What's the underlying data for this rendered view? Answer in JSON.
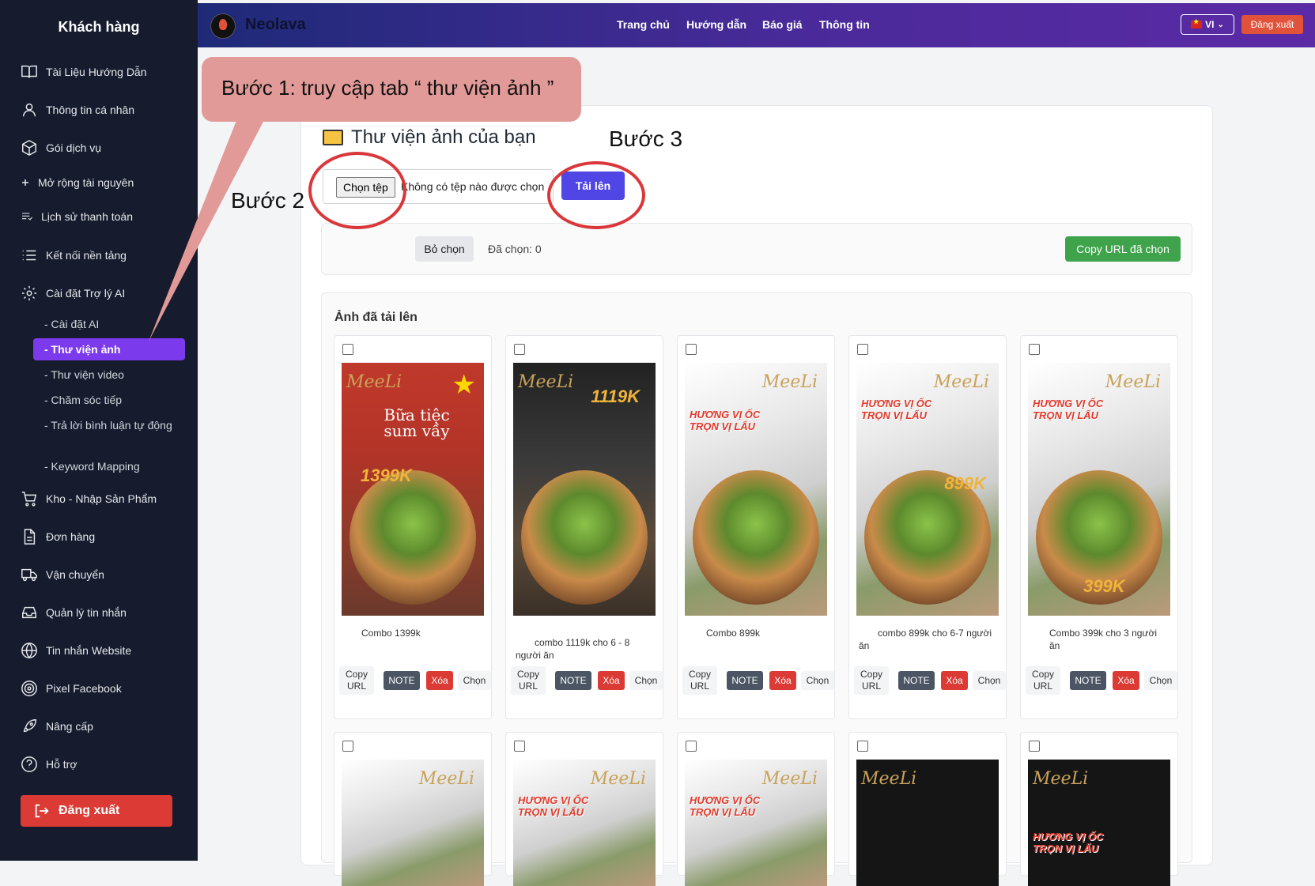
{
  "sidebar": {
    "title": "Khách hàng",
    "items": [
      {
        "label": "Tài Liệu Hướng Dẫn",
        "icon": "book-icon"
      },
      {
        "label": "Thông tin cá nhân",
        "icon": "user-icon"
      },
      {
        "label": "Gói dịch vụ",
        "icon": "box-icon"
      },
      {
        "label": "Mở rộng tài nguyên",
        "icon": "plus-icon"
      },
      {
        "label": "Lịch sử thanh toán",
        "icon": "list-icon"
      },
      {
        "label": "Kết nối nền tảng",
        "icon": "menu-icon"
      },
      {
        "label": "Cài đặt Trợ lý AI",
        "icon": "gear-icon"
      },
      {
        "label": "Kho - Nhập Sản Phẩm",
        "icon": "cart-icon"
      },
      {
        "label": "Đơn hàng",
        "icon": "document-icon"
      },
      {
        "label": "Vận chuyển",
        "icon": "truck-icon"
      },
      {
        "label": "Quản lý tin nhắn",
        "icon": "inbox-icon"
      },
      {
        "label": "Tin nhắn Website",
        "icon": "globe-icon"
      },
      {
        "label": "Pixel Facebook",
        "icon": "target-icon"
      },
      {
        "label": "Nâng cấp",
        "icon": "rocket-icon"
      },
      {
        "label": "Hỗ trợ",
        "icon": "help-icon"
      }
    ],
    "subitems": [
      "- Cài đặt AI",
      "- Thư viện ảnh",
      "- Thư viện video",
      "- Chăm sóc tiếp",
      "- Trả lời bình luận tự động",
      "- Keyword Mapping"
    ],
    "logout": "Đăng xuất"
  },
  "topbar": {
    "brand": "Neolava",
    "nav": [
      "Trang chủ",
      "Hướng dẫn",
      "Báo giá",
      "Thông tin"
    ],
    "lang": "VI",
    "logout": "Đăng xuất"
  },
  "main": {
    "title": "Thư viện ảnh của bạn",
    "file_button": "Chọn tệp",
    "file_status": "Không có tệp nào được chọn",
    "upload_button": "Tải lên",
    "deselect_button": "Bỏ chọn",
    "selected_count": "Đã chọn: 0",
    "copy_selected_button": "Copy URL đã chọn",
    "gallery_title": "Ảnh đã tải lên",
    "tile_buttons": {
      "copy": "Copy URL",
      "note": "NOTE",
      "delete": "Xóa",
      "choose": "Chọn"
    },
    "images": [
      {
        "caption": "Combo 1399k",
        "brand": "MeeLi",
        "price": "1399K"
      },
      {
        "caption": "combo 1119k cho 6 - 8 người ăn",
        "brand": "MeeLi",
        "price": "1119K"
      },
      {
        "caption": "Combo 899k",
        "brand": "MeeLi",
        "price": ""
      },
      {
        "caption": "combo 899k cho 6-7 người ăn",
        "brand": "MeeLi",
        "price": "899K"
      },
      {
        "caption": "Combo 399k cho 3 người ăn",
        "brand": "MeeLi",
        "price": "399K"
      },
      {
        "caption": "",
        "brand": "MeeLi",
        "price": ""
      },
      {
        "caption": "",
        "brand": "MeeLi",
        "price": ""
      },
      {
        "caption": "",
        "brand": "MeeLi",
        "price": ""
      },
      {
        "caption": "",
        "brand": "MeeLi",
        "price": ""
      },
      {
        "caption": "",
        "brand": "MeeLi",
        "price": ""
      }
    ],
    "poster_texts": {
      "red_title": "Bữa tiệc sum vầy",
      "promo": "HƯƠNG VỊ ỐC TRỌN VỊ LẨU"
    }
  },
  "annotations": {
    "step1": "Bước 1: truy cập tab “ thư viện ảnh ”",
    "step2": "Bước 2",
    "step3": "Bước 3"
  },
  "colors": {
    "accent": "#7c3aed",
    "upload": "#4f46e5",
    "danger": "#dc3b35",
    "success": "#3ea34a",
    "callout": "#e19a98",
    "circle": "#d9373a"
  }
}
